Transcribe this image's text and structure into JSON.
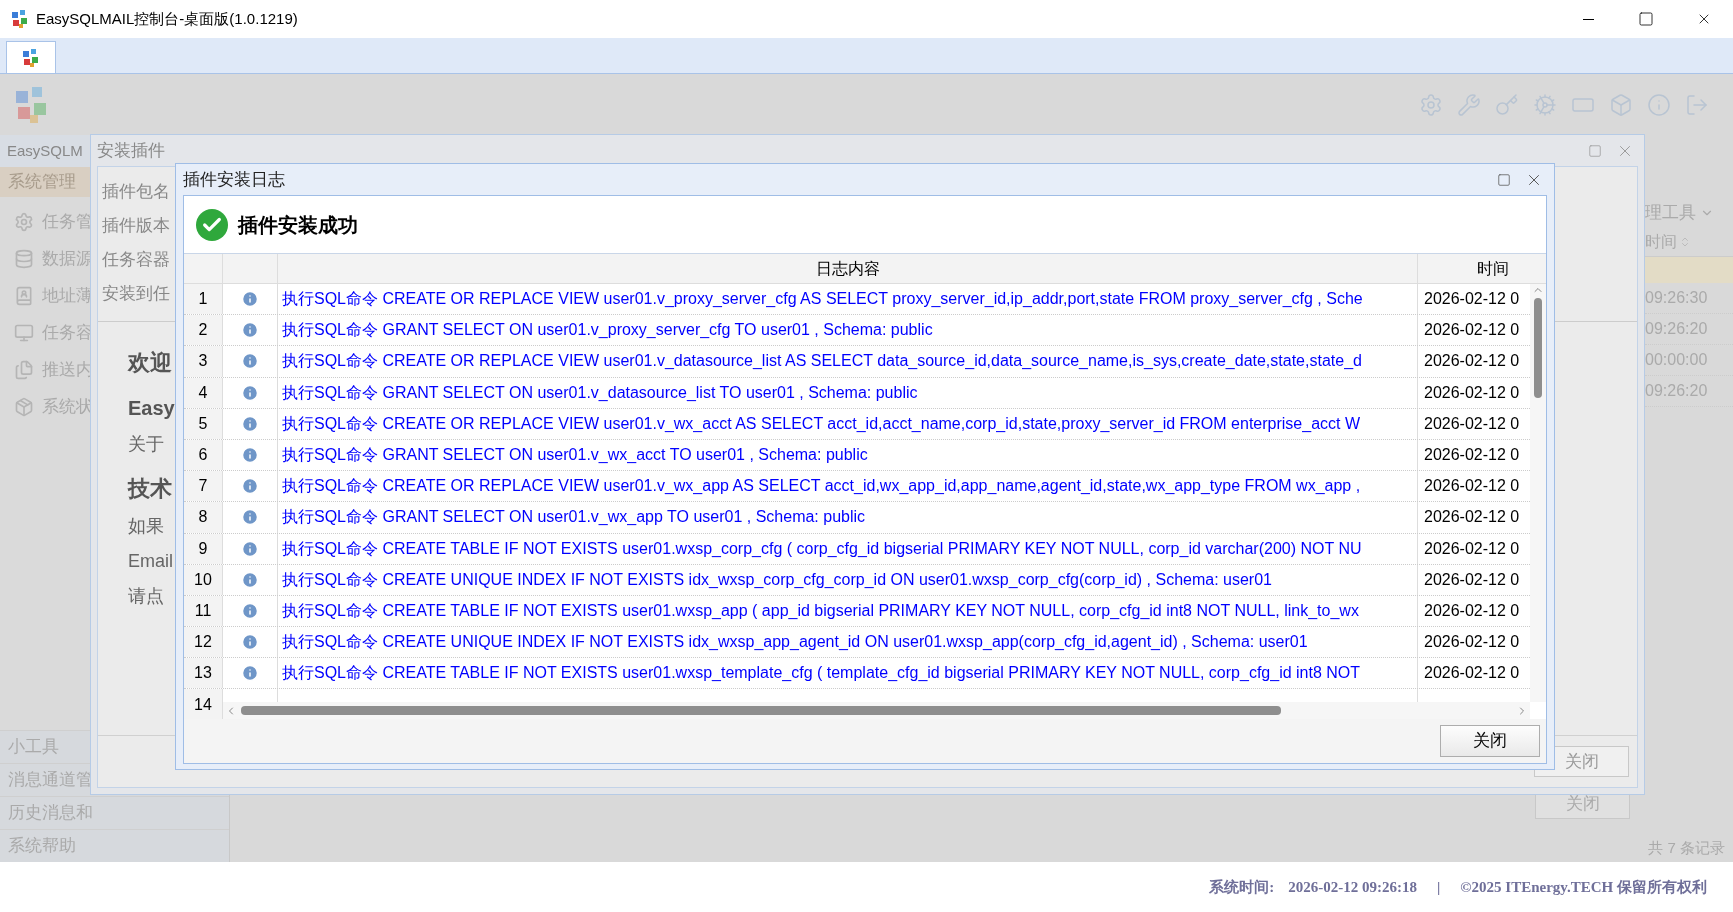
{
  "window": {
    "title": "EasySQLMAIL控制台-桌面版(1.0.1219)"
  },
  "background_app": {
    "sidebar": {
      "header": "EasySQLM",
      "section": "系统管理",
      "items": [
        "任务管",
        "数据源",
        "地址薄",
        "任务容",
        "推送内",
        "系统状"
      ],
      "bottom_items": [
        "小工具",
        "消息通道管",
        "历史消息和",
        "系统帮助"
      ]
    },
    "right_panel": {
      "menu": "理工具",
      "column": "时间",
      "times": [
        "09:26:30",
        "09:26:20",
        "00:00:00",
        "09:26:20"
      ],
      "close_button": "关闭",
      "record_count": "共 7 条记录"
    }
  },
  "install_dialog": {
    "title": "安装插件",
    "fields": [
      "插件包名",
      "插件版本",
      "任务容器",
      "安装到任"
    ],
    "welcome": [
      {
        "text": "欢迎",
        "kind": "heading"
      },
      {
        "text": "Easy",
        "kind": "subheading"
      },
      {
        "text": "关于",
        "kind": "text"
      },
      {
        "text": "技术",
        "kind": "heading"
      },
      {
        "text": "如果",
        "kind": "text"
      },
      {
        "text": "Email",
        "kind": "text"
      },
      {
        "text": "请点",
        "kind": "text"
      }
    ],
    "close_button": "关闭"
  },
  "log_dialog": {
    "title": "插件安装日志",
    "message": "插件安装成功",
    "columns": [
      "日志内容",
      "时间"
    ],
    "rows": [
      {
        "number": "1",
        "text": "执行SQL命令 CREATE OR REPLACE VIEW user01.v_proxy_server_cfg AS SELECT proxy_server_id,ip_addr,port,state FROM proxy_server_cfg , Sche",
        "time": "2026-02-12 0"
      },
      {
        "number": "2",
        "text": "执行SQL命令 GRANT SELECT ON user01.v_proxy_server_cfg TO user01 , Schema: public",
        "time": "2026-02-12 0"
      },
      {
        "number": "3",
        "text": "执行SQL命令 CREATE OR REPLACE VIEW user01.v_datasource_list AS SELECT data_source_id,data_source_name,is_sys,create_date,state,state_d",
        "time": "2026-02-12 0"
      },
      {
        "number": "4",
        "text": "执行SQL命令 GRANT SELECT ON user01.v_datasource_list TO user01 , Schema: public",
        "time": "2026-02-12 0"
      },
      {
        "number": "5",
        "text": "执行SQL命令 CREATE OR REPLACE VIEW user01.v_wx_acct AS SELECT acct_id,acct_name,corp_id,state,proxy_server_id FROM enterprise_acct W",
        "time": "2026-02-12 0"
      },
      {
        "number": "6",
        "text": "执行SQL命令 GRANT SELECT ON user01.v_wx_acct TO user01 , Schema: public",
        "time": "2026-02-12 0"
      },
      {
        "number": "7",
        "text": "执行SQL命令 CREATE OR REPLACE VIEW user01.v_wx_app AS SELECT acct_id,wx_app_id,app_name,agent_id,state,wx_app_type FROM wx_app ,",
        "time": "2026-02-12 0"
      },
      {
        "number": "8",
        "text": "执行SQL命令 GRANT SELECT ON user01.v_wx_app TO user01 , Schema: public",
        "time": "2026-02-12 0"
      },
      {
        "number": "9",
        "text": "执行SQL命令 CREATE TABLE IF NOT EXISTS user01.wxsp_corp_cfg ( corp_cfg_id bigserial PRIMARY KEY NOT NULL, corp_id varchar(200) NOT NU",
        "time": "2026-02-12 0"
      },
      {
        "number": "10",
        "text": "执行SQL命令 CREATE UNIQUE INDEX IF NOT EXISTS idx_wxsp_corp_cfg_corp_id ON user01.wxsp_corp_cfg(corp_id) , Schema: user01",
        "time": "2026-02-12 0"
      },
      {
        "number": "11",
        "text": "执行SQL命令 CREATE TABLE IF NOT EXISTS user01.wxsp_app ( app_id bigserial PRIMARY KEY NOT NULL, corp_cfg_id int8 NOT NULL, link_to_wx",
        "time": "2026-02-12 0"
      },
      {
        "number": "12",
        "text": "执行SQL命令 CREATE UNIQUE INDEX IF NOT EXISTS idx_wxsp_app_agent_id ON user01.wxsp_app(corp_cfg_id,agent_id) , Schema: user01",
        "time": "2026-02-12 0"
      },
      {
        "number": "13",
        "text": "执行SQL命令 CREATE TABLE IF NOT EXISTS user01.wxsp_template_cfg ( template_cfg_id bigserial PRIMARY KEY NOT NULL, corp_cfg_id int8 NOT",
        "time": "2026-02-12 0"
      },
      {
        "number": "14"
      }
    ],
    "close_button": "关闭"
  },
  "status_bar": {
    "label": "系统时间:",
    "time": "2026-02-12 09:26:18",
    "separator": "|",
    "copyright": "©2025 ITEnergy.TECH 保留所有权利"
  }
}
